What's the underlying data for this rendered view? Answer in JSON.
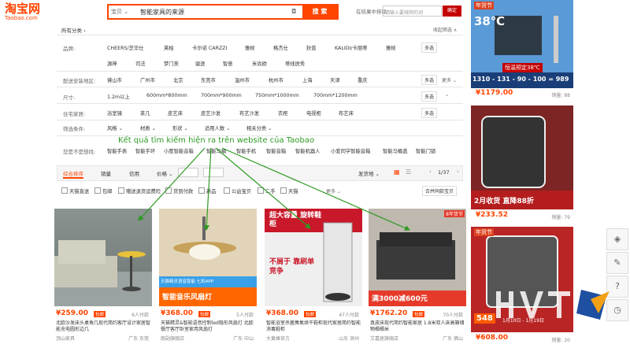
{
  "header": {
    "logo_main": "淘宝网",
    "logo_sub": "Taobao.com",
    "search_category": "宝贝 ⌄",
    "search_query": "智能家具的来源",
    "search_button": "搜 索",
    "within_label": "在结果中排除",
    "within_placeholder": "请输入要排除的词",
    "within_button": "确定"
  },
  "categories": {
    "all_label": "所有分类 ›",
    "collapse_label": "收起筛选 ∧"
  },
  "filters": {
    "brand_label": "品牌:",
    "brands_row1": [
      "CHEERS/芝华仕",
      "芙柏",
      "卡尔诺 CARZZI",
      "雅帧",
      "格杰仕",
      "狄普",
      "KALIDI/卡丽蒂",
      "雅帧"
    ],
    "brands_row2": [
      "源神",
      "司法",
      "梦门美",
      "骏逐",
      "智意",
      "米尚欧",
      "蒂线居秀"
    ],
    "delivery_label": "配送安装地区:",
    "delivery": [
      "佛山市",
      "广州市",
      "北京",
      "东莞市",
      "温州市",
      "杭州市",
      "上海",
      "天津",
      "重庆"
    ],
    "size_label": "尺寸:",
    "sizes": [
      "1.2m以上",
      "600mm*800mm",
      "700mm*900mm",
      "750mm*1000mm",
      "700mm*1200mm"
    ],
    "space_label": "住宅家居:",
    "spaces": [
      "浴室镜",
      "茶几",
      "皮艺床",
      "皮艺沙发",
      "布艺沙发",
      "衣柜",
      "电视柜",
      "布艺床"
    ],
    "pick_label": "筛选条件:",
    "picks": [
      "风格 ⌄",
      "材质 ⌄",
      "形状 ⌄",
      "适用人数 ⌄",
      "相关分类 ⌄"
    ],
    "related_label": "您是不是想找:",
    "related": [
      "智能手表",
      "智能手环",
      "小度智能音箱",
      "智能马桶",
      "智能手机",
      "智能音箱",
      "智能机器人",
      "小爱同学智能音箱",
      "智能马桶盖",
      "智能门锁"
    ],
    "multi_label": "多选",
    "more_label": "更多 ⌄"
  },
  "sortbar": {
    "tabs": [
      "综合排序",
      "销量",
      "信用",
      "价格 ⌄"
    ],
    "ship_from": "发货地 ⌄",
    "page": "1/37",
    "checks": [
      "天猫直送",
      "包邮",
      "赠送退货运费险",
      "货到付款",
      "新品",
      "公益宝贝",
      "二手",
      "天猫"
    ],
    "more": "更多 ⌄",
    "open_store": "合并同款宝贝"
  },
  "annotation": "Kết quả tìm kiếm hiện ra trên website của Taobao",
  "products": [
    {
      "price": "¥259.00",
      "badge": "包邮",
      "paid": "6人付款",
      "title": "北欧沙发床头桌角几现代简约客厅设计家居智能充电圆形边几",
      "shop": "顶山家具",
      "loc": "广东 东莞"
    },
    {
      "price": "¥368.00",
      "badge": "包邮",
      "paid": "5人付款",
      "title": "天猫精灵&智能语音控制led隐形风扇灯 北欧餐厅客厅卧室家用风扇灯",
      "shop": "朗勋旗舰店",
      "loc": "广东 中山",
      "banner": "智能音乐风扇灯",
      "banner_top": "天猫精灵语音智能 七彩APP"
    },
    {
      "price": "¥368.00",
      "badge": "包邮",
      "paid": "47人付款",
      "title": "智能浴室杀菌臭氧烘干鞋柜现代家居简约智能消毒鞋柜",
      "shop": "大黄蜂官方",
      "loc": "山东 滨州",
      "banner": "超大容量 旋转鞋柜",
      "banner2": "不屑于 靠刷单竞争"
    },
    {
      "price": "¥1762.20",
      "badge": "包邮",
      "paid": "70人付款",
      "title": "真皮床现代简约智能家居 1.8米双人床高箱储物榻榻米",
      "shop": "艾嘉居旗舰店",
      "loc": "广东 佛山",
      "banner": "满3000减600元",
      "tag": "8年货节"
    }
  ],
  "right_products": [
    {
      "price": "¥1179.00",
      "sales": "销量: 88",
      "tag": "年货节",
      "temp": "38℃",
      "offer": "恒温预定38℃",
      "stats": "1310 - 131 - 90 - 100 = 989"
    },
    {
      "price": "¥233.52",
      "sales": "销量: 79",
      "promo": "2月收货 直降88折"
    },
    {
      "price": "¥608.00",
      "sales": "销量: 20",
      "tag": "年货节",
      "price_tag": "548",
      "range": "1月10日 - 1月19日"
    }
  ],
  "sidebar": {
    "icons": [
      "cube-icon",
      "pencil-icon",
      "question-icon",
      "clock-icon"
    ]
  },
  "colors": {
    "accent": "#ff4400",
    "tmall": "#c40000",
    "annotation": "#2f9a25"
  }
}
